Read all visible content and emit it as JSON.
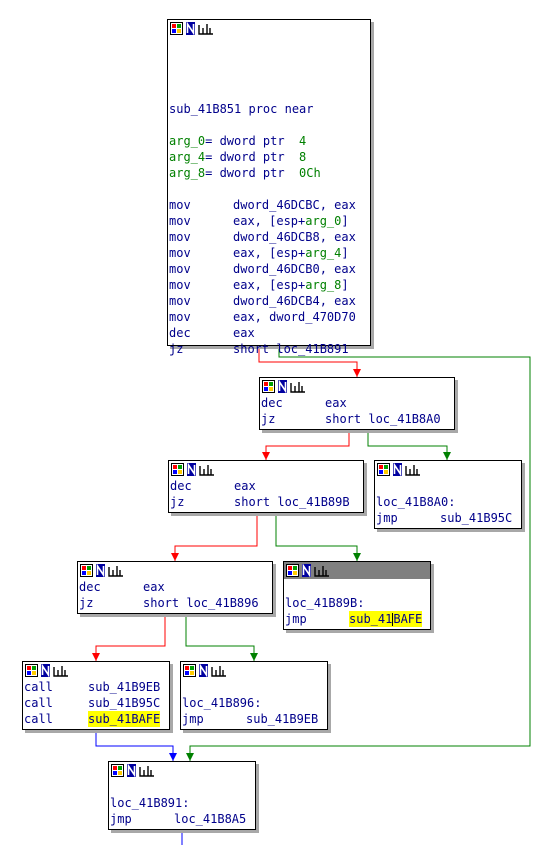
{
  "colors": {
    "background": "#ffffff",
    "code_text": "#00008b",
    "argument_text": "#008000",
    "highlight": "#ffff00",
    "edge_true": "#008000",
    "edge_false": "#ff0000",
    "edge_unconditional": "#0000ff",
    "active_header": "#808080"
  },
  "icons": {
    "graph": "graph-overview-icon",
    "name": "rename-icon",
    "xref": "xrefs-icon"
  },
  "blocks": {
    "b0": {
      "proc_line": "sub_41B851 proc near",
      "args": [
        {
          "name": "arg_0",
          "decl": "= dword ptr  ",
          "value": "4"
        },
        {
          "name": "arg_4",
          "decl": "= dword ptr  ",
          "value": "8"
        },
        {
          "name": "arg_8",
          "decl": "= dword ptr  ",
          "value": "0Ch"
        }
      ],
      "instructions": [
        {
          "mnemonic": "mov",
          "pre": "dword_46DCBC, eax",
          "arg": "",
          "post": ""
        },
        {
          "mnemonic": "mov",
          "pre": "eax, [esp+",
          "arg": "arg_0",
          "post": "]"
        },
        {
          "mnemonic": "mov",
          "pre": "dword_46DCB8, eax",
          "arg": "",
          "post": ""
        },
        {
          "mnemonic": "mov",
          "pre": "eax, [esp+",
          "arg": "arg_4",
          "post": "]"
        },
        {
          "mnemonic": "mov",
          "pre": "dword_46DCB0, eax",
          "arg": "",
          "post": ""
        },
        {
          "mnemonic": "mov",
          "pre": "eax, [esp+",
          "arg": "arg_8",
          "post": "]"
        },
        {
          "mnemonic": "mov",
          "pre": "dword_46DCB4, eax",
          "arg": "",
          "post": ""
        },
        {
          "mnemonic": "mov",
          "pre": "eax, dword_470D70",
          "arg": "",
          "post": ""
        },
        {
          "mnemonic": "dec",
          "pre": "eax",
          "arg": "",
          "post": ""
        },
        {
          "mnemonic": "jz",
          "pre": "short loc_41B891",
          "arg": "",
          "post": ""
        }
      ]
    },
    "b1": {
      "instructions": [
        {
          "mnemonic": "dec",
          "operand": "eax"
        },
        {
          "mnemonic": "jz",
          "operand": "short loc_41B8A0"
        }
      ]
    },
    "b2": {
      "instructions": [
        {
          "mnemonic": "dec",
          "operand": "eax"
        },
        {
          "mnemonic": "jz",
          "operand": "short loc_41B89B"
        }
      ]
    },
    "b3": {
      "label": "loc_41B8A0:",
      "mnemonic": "jmp",
      "operand": "sub_41B95C"
    },
    "b4": {
      "instructions": [
        {
          "mnemonic": "dec",
          "operand": "eax"
        },
        {
          "mnemonic": "jz",
          "operand": "short loc_41B896"
        }
      ]
    },
    "b5": {
      "label": "loc_41B89B:",
      "mnemonic": "jmp",
      "operand_a": "sub_41",
      "operand_b": "BAFE"
    },
    "b6": {
      "instructions": [
        {
          "mnemonic": "call",
          "operand": "sub_41B9EB",
          "highlighted": false
        },
        {
          "mnemonic": "call",
          "operand": "sub_41B95C",
          "highlighted": false
        },
        {
          "mnemonic": "call",
          "operand": "sub_41BAFE",
          "highlighted": true
        }
      ]
    },
    "b7": {
      "label": "loc_41B896:",
      "mnemonic": "jmp",
      "operand": "sub_41B9EB"
    },
    "b8": {
      "label": "loc_41B891:",
      "mnemonic": "jmp",
      "operand": "loc_41B8A5"
    }
  }
}
